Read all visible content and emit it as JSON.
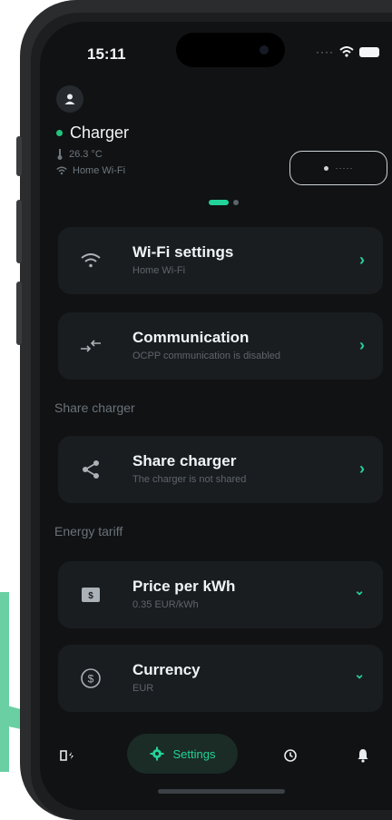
{
  "status_bar": {
    "time": "15:11"
  },
  "header": {
    "charger_name": "Charger",
    "temperature": "26.3 °C",
    "network": "Home Wi-Fi"
  },
  "cards": [
    {
      "title": "Wi-Fi settings",
      "subtitle": "Home Wi-Fi",
      "icon": "wifi-icon",
      "control": "chevron-right"
    },
    {
      "title": "Communication",
      "subtitle": "OCPP communication is disabled",
      "icon": "communication-icon",
      "control": "chevron-right"
    }
  ],
  "sections": {
    "share": {
      "label": "Share charger",
      "card": {
        "title": "Share charger",
        "subtitle": "The charger is not shared",
        "icon": "share-icon",
        "control": "chevron-right"
      }
    },
    "tariff": {
      "label": "Energy tariff",
      "cards": [
        {
          "title": "Price per kWh",
          "subtitle": "0.35 EUR/kWh",
          "icon": "price-icon",
          "control": "chevron-down"
        },
        {
          "title": "Currency",
          "subtitle": "EUR",
          "icon": "currency-icon",
          "control": "chevron-down"
        }
      ]
    }
  },
  "nav": {
    "active_label": "Settings",
    "items": [
      "charge-icon",
      "settings-icon",
      "history-icon",
      "notifications-icon"
    ]
  },
  "colors": {
    "accent": "#22d39a",
    "background": "#101214",
    "card": "#1a1d20",
    "callout": "#5cc49a"
  }
}
